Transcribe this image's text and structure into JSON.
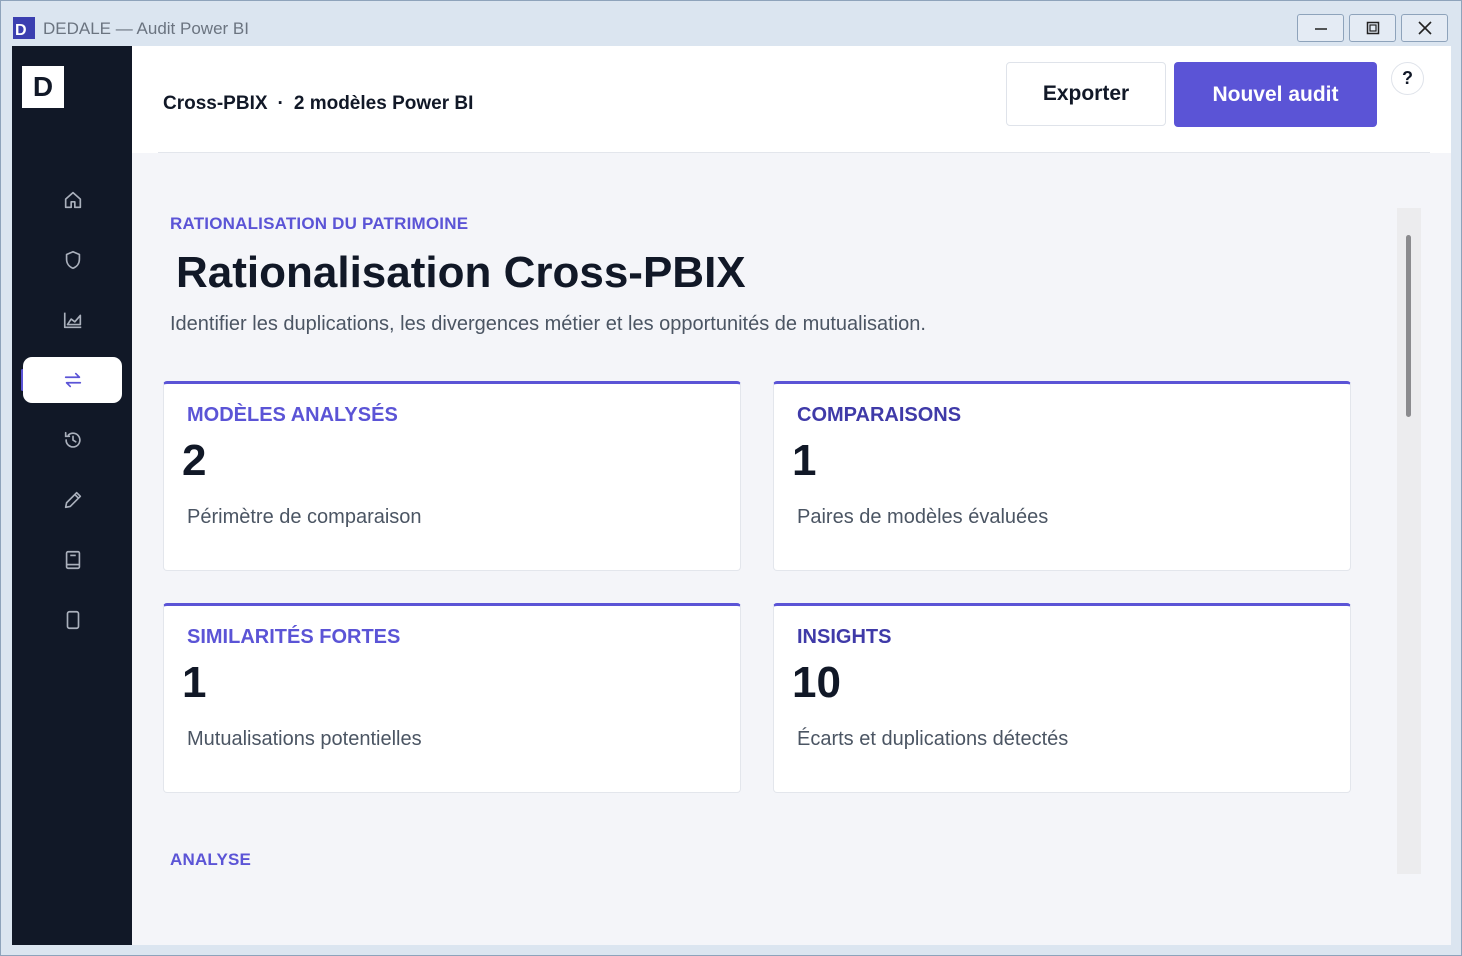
{
  "window": {
    "app_icon_letter": "D",
    "title": "DEDALE — Audit Power BI"
  },
  "sidebar": {
    "logo": "D",
    "items": [
      {
        "icon": "home-icon"
      },
      {
        "icon": "shield-icon"
      },
      {
        "icon": "chart-icon"
      },
      {
        "icon": "compare-arrows-icon",
        "active": true
      },
      {
        "icon": "history-icon"
      },
      {
        "icon": "pencil-icon"
      },
      {
        "icon": "book-icon"
      },
      {
        "icon": "page-icon"
      }
    ]
  },
  "header": {
    "breadcrumb_scope": "Cross-PBIX",
    "breadcrumb_separator": "·",
    "breadcrumb_detail": "2 modèles Power BI",
    "export_label": "Exporter",
    "new_audit_label": "Nouvel audit",
    "help_label": "?"
  },
  "main": {
    "eyebrow": "RATIONALISATION DU PATRIMOINE",
    "title": "Rationalisation Cross-PBIX",
    "description": "Identifier les duplications, les divergences métier et les opportunités de mutualisation.",
    "cards": [
      {
        "label": "MODÈLES ANALYSÉS",
        "value": "2",
        "sub": "Périmètre de comparaison"
      },
      {
        "label": "COMPARAISONS",
        "value": "1",
        "sub": "Paires de modèles évaluées"
      },
      {
        "label": "SIMILARITÉS FORTES",
        "value": "1",
        "sub": "Mutualisations potentielles"
      },
      {
        "label": "INSIGHTS",
        "value": "10",
        "sub": "Écarts et duplications détectés"
      }
    ],
    "section_analysis": "ANALYSE"
  },
  "colors": {
    "accent": "#5b54d6",
    "sidebar_bg": "#111827",
    "text_primary": "#111827",
    "text_secondary": "#4b5563"
  }
}
